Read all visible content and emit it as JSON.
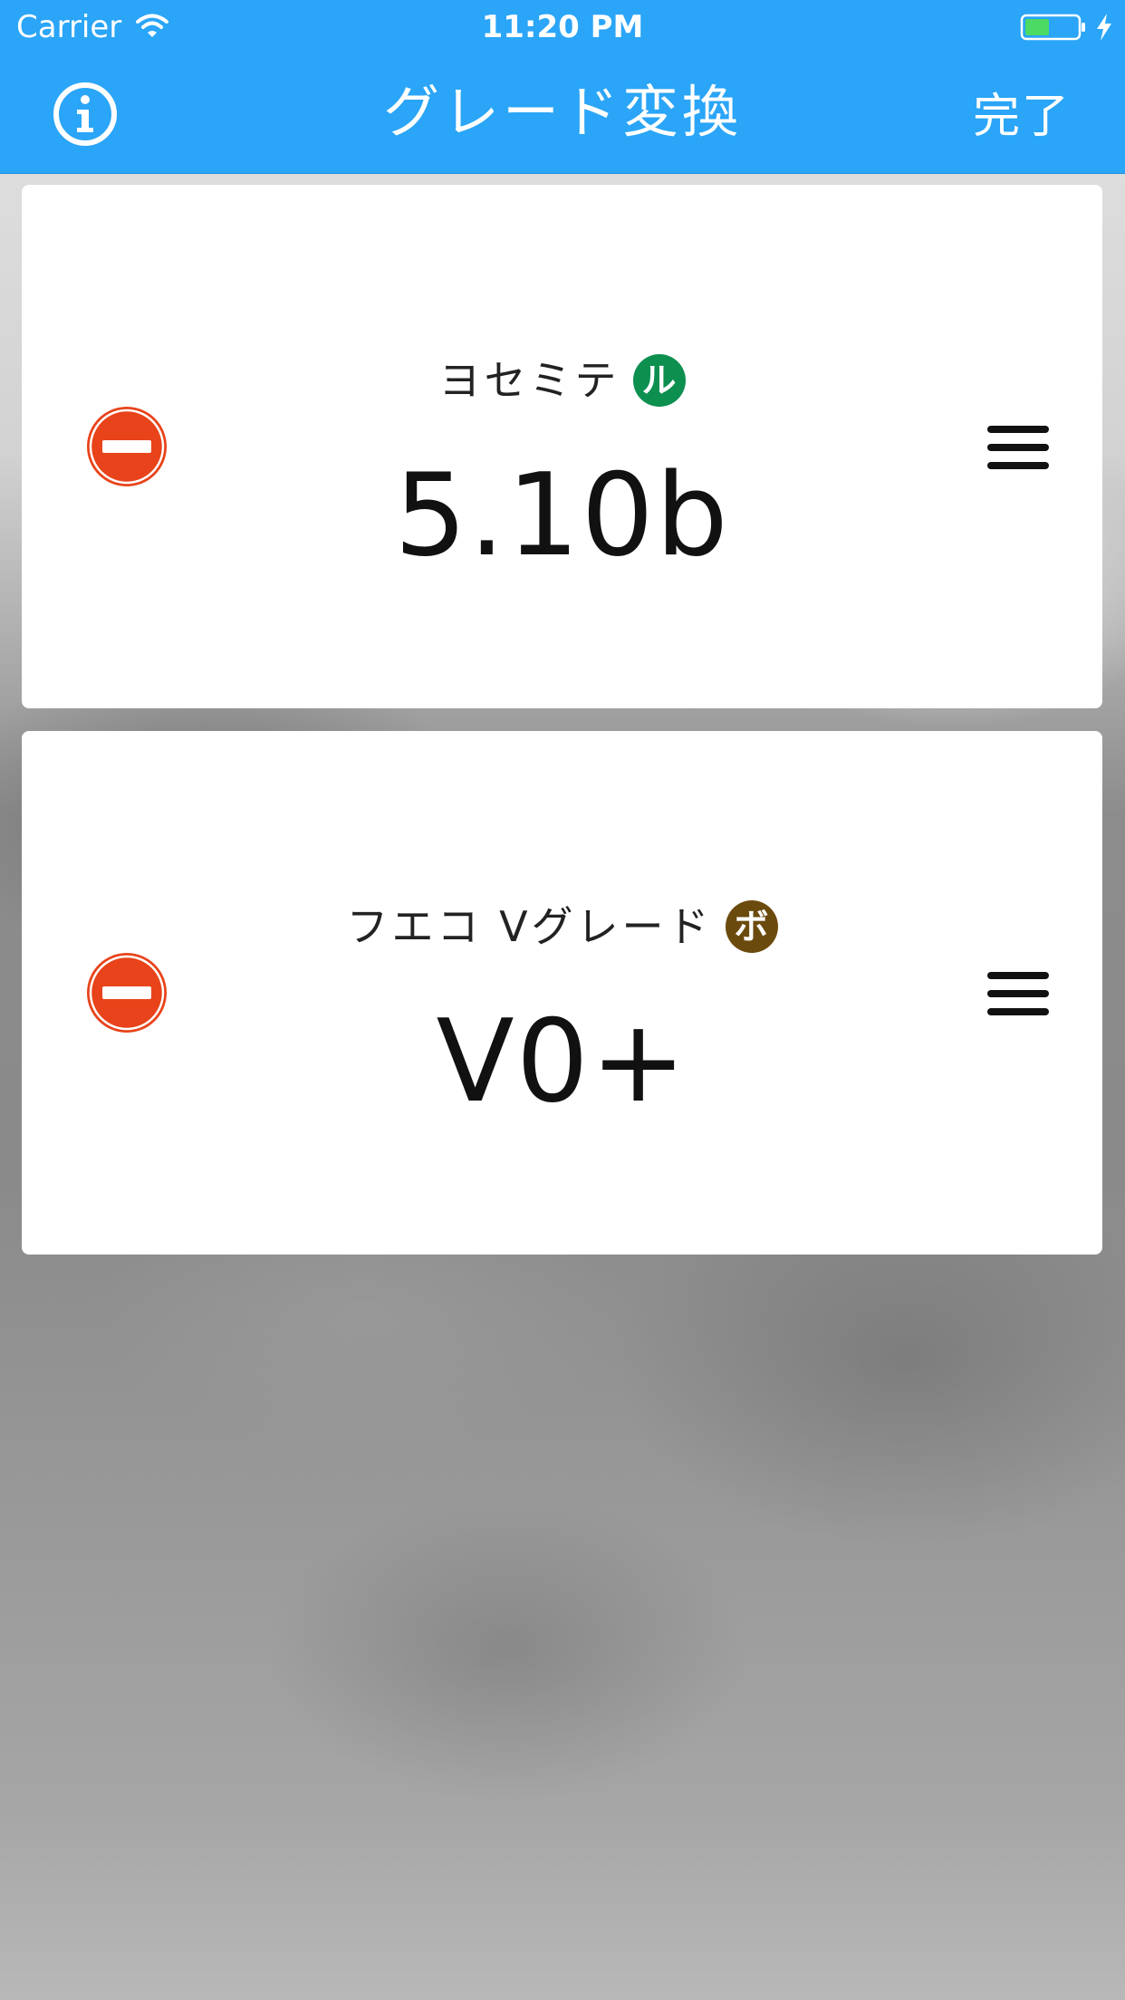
{
  "status_bar": {
    "carrier": "Carrier",
    "time": "11:20 PM",
    "battery_icon": "battery-charging-icon",
    "wifi_icon": "wifi-icon"
  },
  "nav_bar": {
    "title": "グレード変換",
    "info_icon": "info-icon",
    "done_label": "完了",
    "background_color": "#2aa5f7"
  },
  "cards": [
    {
      "scale_name": "ヨセミテ",
      "badge": "ル",
      "badge_color": "#0d8f4f",
      "grade": "5.10b",
      "delete_icon": "minus-circle-icon",
      "reorder_icon": "hamburger-icon"
    },
    {
      "scale_name": "フエコ Vグレード",
      "badge": "ボ",
      "badge_color": "#6b4a0d",
      "grade": "V0+",
      "delete_icon": "minus-circle-icon",
      "reorder_icon": "hamburger-icon"
    }
  ],
  "colors": {
    "delete_red": "#e8431a",
    "text": "#111111"
  }
}
